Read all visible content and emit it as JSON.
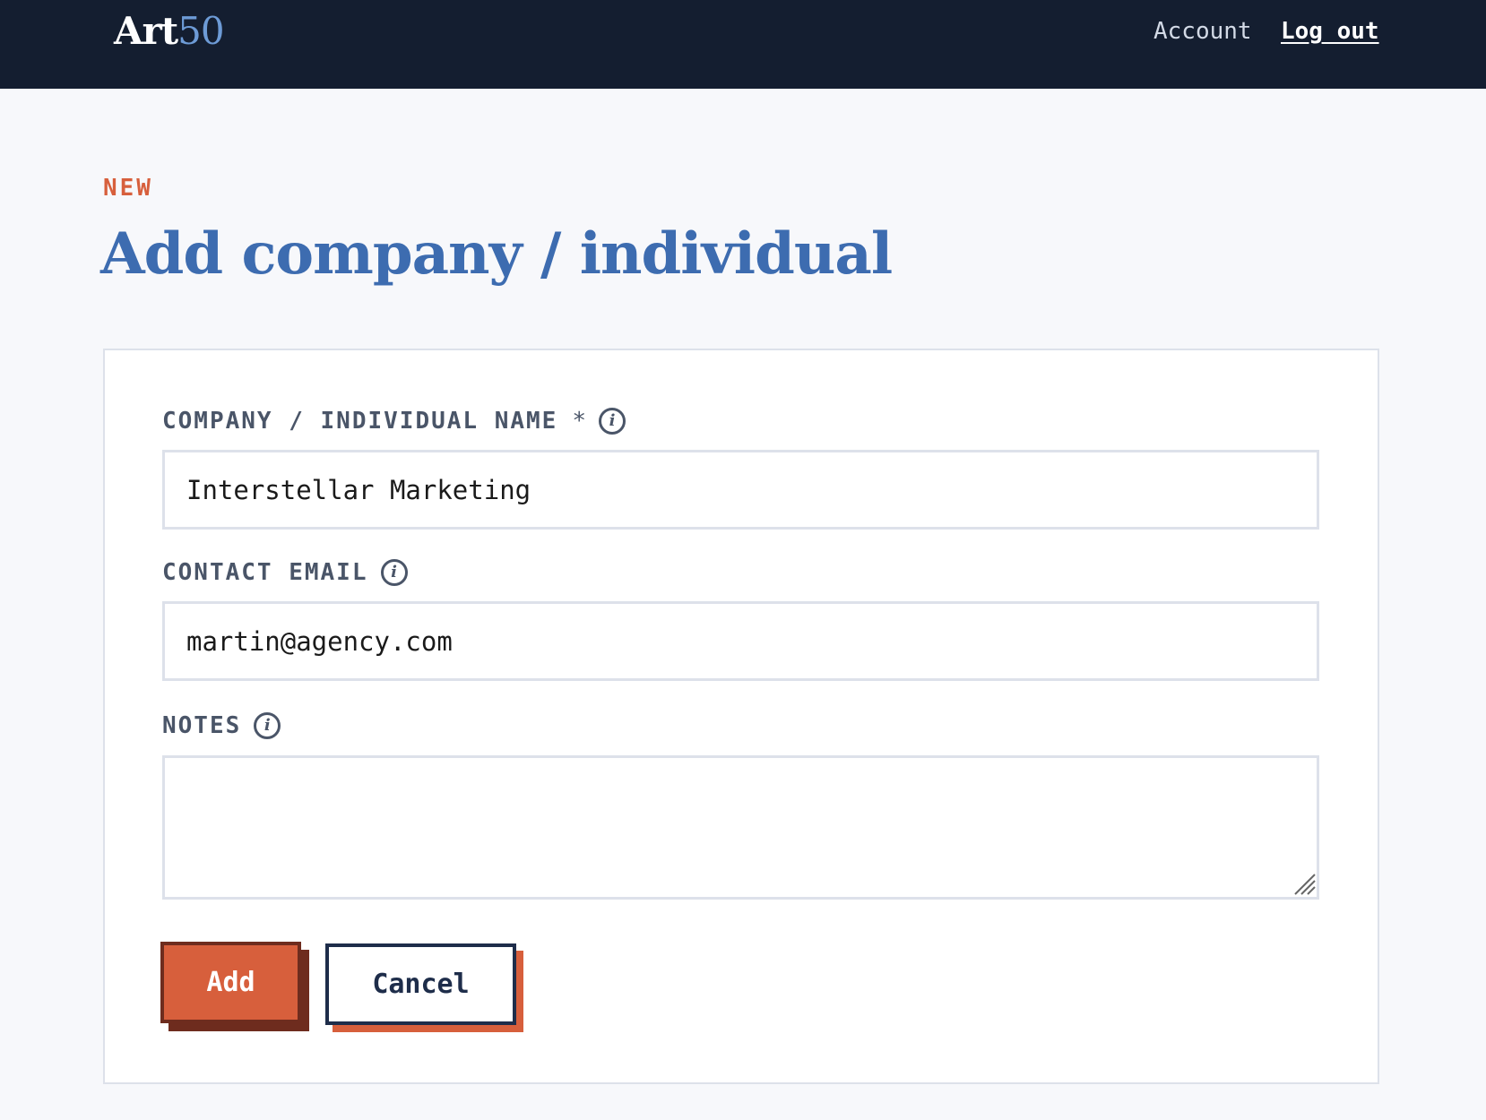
{
  "header": {
    "logo_text": "Art",
    "logo_number": "50",
    "nav": {
      "account_label": "Account",
      "logout_label": "Log out"
    }
  },
  "page": {
    "eyebrow": "NEW",
    "title": "Add company / individual"
  },
  "form": {
    "name_field": {
      "label": "COMPANY / INDIVIDUAL NAME",
      "required_marker": "*",
      "value": "Interstellar Marketing",
      "info_icon": "info-icon"
    },
    "email_field": {
      "label": "CONTACT EMAIL",
      "value": "martin@agency.com",
      "info_icon": "info-icon"
    },
    "notes_field": {
      "label": "NOTES",
      "value": "",
      "info_icon": "info-icon"
    },
    "buttons": {
      "add_label": "Add",
      "cancel_label": "Cancel"
    }
  },
  "colors": {
    "header_bg": "#141e30",
    "accent_orange": "#d75f3c",
    "title_blue": "#3d6cb0",
    "logo_blue": "#6d9bd6",
    "navy": "#1e2d4a"
  }
}
